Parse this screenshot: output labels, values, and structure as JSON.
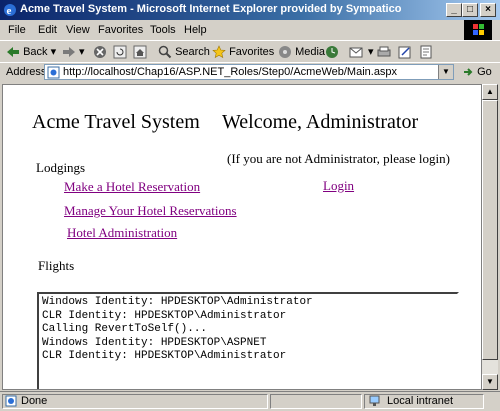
{
  "window": {
    "title": "Acme Travel System - Microsoft Internet Explorer provided by Sympatico"
  },
  "menu": [
    "File",
    "Edit",
    "View",
    "Favorites",
    "Tools",
    "Help"
  ],
  "toolbar": {
    "back": "Back",
    "search": "Search",
    "favorites": "Favorites",
    "media": "Media"
  },
  "address": {
    "label": "Address",
    "url": "http://localhost/Chap16/ASP.NET_Roles/Step0/AcmeWeb/Main.aspx",
    "go": "Go"
  },
  "page": {
    "site_title": "Acme Travel System",
    "welcome": "Welcome, Administrator",
    "login_note": "(If you are not Administrator, please login)",
    "login_link": "Login",
    "lodgings_heading": "Lodgings",
    "links": [
      "Make a Hotel Reservation",
      "Manage Your Hotel Reservations",
      "Hotel Administration"
    ],
    "flights_heading": "Flights",
    "output_lines": [
      "Windows Identity: HPDESKTOP\\Administrator",
      "CLR Identity: HPDESKTOP\\Administrator",
      "Calling RevertToSelf()...",
      "Windows Identity: HPDESKTOP\\ASPNET",
      "CLR Identity: HPDESKTOP\\Administrator"
    ]
  },
  "status": {
    "text": "Done",
    "zone": "Local intranet"
  }
}
